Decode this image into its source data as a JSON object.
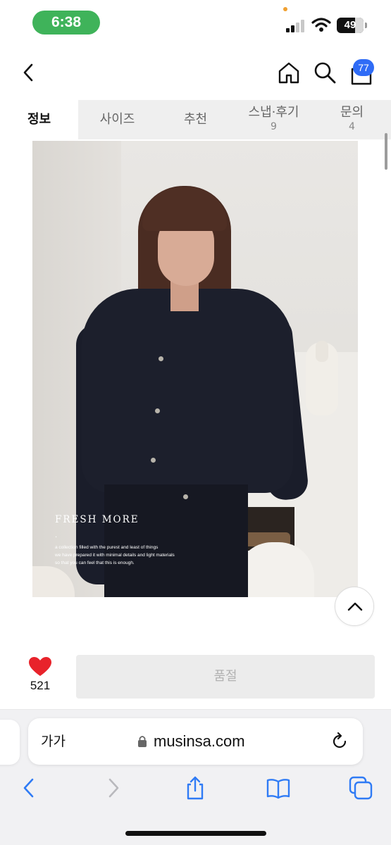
{
  "status_bar": {
    "time": "6:38",
    "battery": "49",
    "signal_bars_active": 2,
    "signal_bars_total": 4,
    "icons": [
      "signal-icon",
      "wifi-icon",
      "battery-icon"
    ]
  },
  "header": {
    "icons": [
      "back-icon",
      "home-icon",
      "search-icon",
      "cart-icon"
    ],
    "cart_badge": "77",
    "badge_color": "#2f6cf6"
  },
  "tabs": [
    {
      "label": "정보",
      "count": "",
      "active": true
    },
    {
      "label": "사이즈",
      "count": "",
      "active": false
    },
    {
      "label": "추천",
      "count": "",
      "active": false
    },
    {
      "label": "스냅·후기",
      "count": "9",
      "active": false
    },
    {
      "label": "문의",
      "count": "4",
      "active": false
    }
  ],
  "product_image": {
    "title": "FRESH MORE",
    "dot": "·",
    "description": [
      "a collection filled with the purest and least of things",
      "we have prepared it with minimal details and light materials",
      "so that you can feel that this is enough."
    ]
  },
  "purchase": {
    "like_count": "521",
    "like_color": "#e8232b",
    "soldout_label": "품절"
  },
  "safari": {
    "text_size_label": "가가",
    "url": "musinsa.com",
    "toolbar_icons": [
      "back-icon",
      "forward-icon",
      "share-icon",
      "bookmarks-icon",
      "tabs-icon"
    ],
    "accent_color": "#2f7bf5"
  }
}
